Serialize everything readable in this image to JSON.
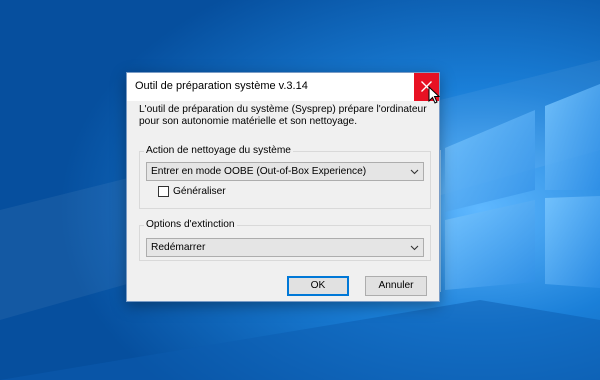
{
  "dialog": {
    "title": "Outil de préparation système v.3.14",
    "description": "L'outil de préparation du système (Sysprep) prépare l'ordinateur pour son autonomie matérielle et son nettoyage.",
    "cleanup_group": {
      "legend": "Action de nettoyage du système",
      "selected_option": "Entrer en mode OOBE (Out-of-Box Experience)",
      "generalize_label": "Généraliser",
      "generalize_checked": false
    },
    "shutdown_group": {
      "legend": "Options d'extinction",
      "selected_option": "Redémarrer"
    },
    "ok_label": "OK",
    "cancel_label": "Annuler"
  },
  "icons": {
    "close": "close-icon",
    "dropdown": "chevron-down-icon",
    "cursor": "mouse-pointer-icon"
  },
  "colors": {
    "desktop_background": "#0a6fc7",
    "close_button": "#e81123",
    "default_button_border": "#0078d7"
  }
}
